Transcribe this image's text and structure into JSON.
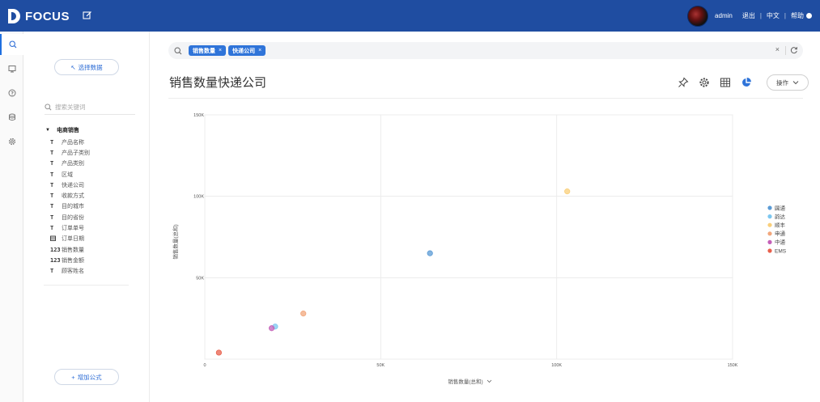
{
  "topbar": {
    "logo_text": "FOCUS",
    "user_name": "admin",
    "logout": "退出",
    "language": "中文",
    "help": "帮助",
    "separator": "|"
  },
  "rail": {
    "icons": [
      "search-icon",
      "board-icon",
      "help-icon",
      "data-source-icon",
      "settings-icon"
    ]
  },
  "panel": {
    "select_data_label": "选择数据",
    "search_placeholder": "搜索关键词",
    "root_label": "电商销售",
    "fields": [
      {
        "type": "T",
        "label": "产品名称"
      },
      {
        "type": "T",
        "label": "产品子类别"
      },
      {
        "type": "T",
        "label": "产品类别"
      },
      {
        "type": "T",
        "label": "区域"
      },
      {
        "type": "T",
        "label": "快递公司"
      },
      {
        "type": "T",
        "label": "收款方式"
      },
      {
        "type": "T",
        "label": "目的城市"
      },
      {
        "type": "T",
        "label": "目的省份"
      },
      {
        "type": "T",
        "label": "订单单号"
      },
      {
        "type": "date",
        "label": "订单日期"
      },
      {
        "type": "123",
        "label": "销售数量"
      },
      {
        "type": "123",
        "label": "销售金额"
      },
      {
        "type": "T",
        "label": "顾客姓名"
      }
    ],
    "add_formula_label": "增加公式"
  },
  "query": {
    "tokens": [
      "销售数量",
      "快递公司"
    ],
    "clear": "×"
  },
  "main": {
    "title": "销售数量快递公司",
    "ops_label": "操作"
  },
  "colors": {
    "brand": "#1f4da1",
    "accent": "#2f74d9"
  },
  "chart_data": {
    "type": "scatter",
    "xlabel": "销售数量(总和)",
    "ylabel": "销售数量(总和)",
    "xlim": [
      0,
      150000
    ],
    "ylim": [
      0,
      150000
    ],
    "x_ticks": [
      "0",
      "50K",
      "100K",
      "150K"
    ],
    "y_ticks": [
      "50K",
      "100K",
      "150K"
    ],
    "grid": true,
    "legend_position": "right",
    "series": [
      {
        "name": "圆通",
        "color": "#5b9bd5",
        "points": [
          [
            64000,
            65000
          ]
        ]
      },
      {
        "name": "韵达",
        "color": "#7cc7f0",
        "points": [
          [
            20000,
            20000
          ]
        ]
      },
      {
        "name": "顺丰",
        "color": "#f9cf7a",
        "points": [
          [
            103000,
            103000
          ]
        ]
      },
      {
        "name": "申通",
        "color": "#f2a77c",
        "points": [
          [
            28000,
            28000
          ]
        ]
      },
      {
        "name": "中通",
        "color": "#c460b8",
        "points": [
          [
            19000,
            19000
          ]
        ]
      },
      {
        "name": "EMS",
        "color": "#e8604c",
        "points": [
          [
            4000,
            4000
          ]
        ]
      }
    ]
  }
}
